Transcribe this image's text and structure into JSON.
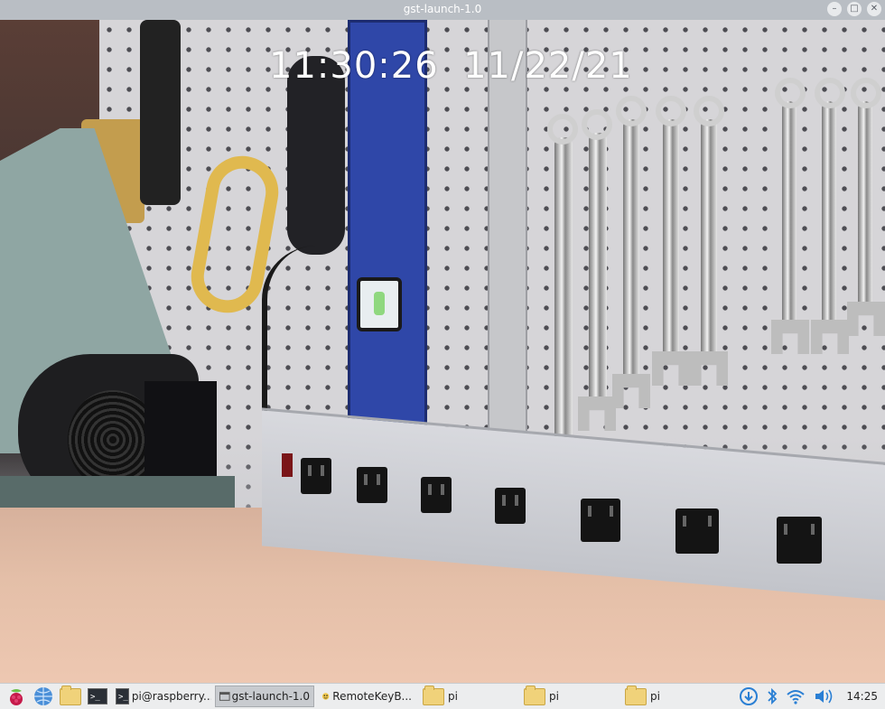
{
  "window": {
    "title": "gst-launch-1.0",
    "controls": [
      "minimize-icon",
      "maximize-icon",
      "close-icon"
    ],
    "minimize_glyph": "–",
    "maximize_glyph": "□",
    "close_glyph": "✕"
  },
  "video": {
    "overlay_text": "11:30:26  11/22/21"
  },
  "taskbar": {
    "launchers": [
      "raspberry-menu-icon",
      "web-browser-icon",
      "file-manager-icon",
      "terminal-icon"
    ],
    "term_glyph": ">_",
    "tasks": [
      {
        "label": "pi@raspberry...",
        "icon": "terminal-icon"
      },
      {
        "label": "gst-launch-1.0",
        "icon": "window-icon"
      },
      {
        "label": "RemoteKeyB...",
        "icon": "remotekey-icon"
      },
      {
        "label": "pi",
        "icon": "folder-icon"
      },
      {
        "label": "pi",
        "icon": "folder-icon"
      },
      {
        "label": "pi",
        "icon": "folder-icon"
      }
    ],
    "tray": [
      "updates-icon",
      "bluetooth-icon",
      "wifi-icon",
      "volume-icon"
    ],
    "clock": "14:25"
  },
  "colors": {
    "titlebar": "#b9bec4",
    "taskbar": "#ecedee",
    "tray_accent": "#2a7fd4"
  }
}
